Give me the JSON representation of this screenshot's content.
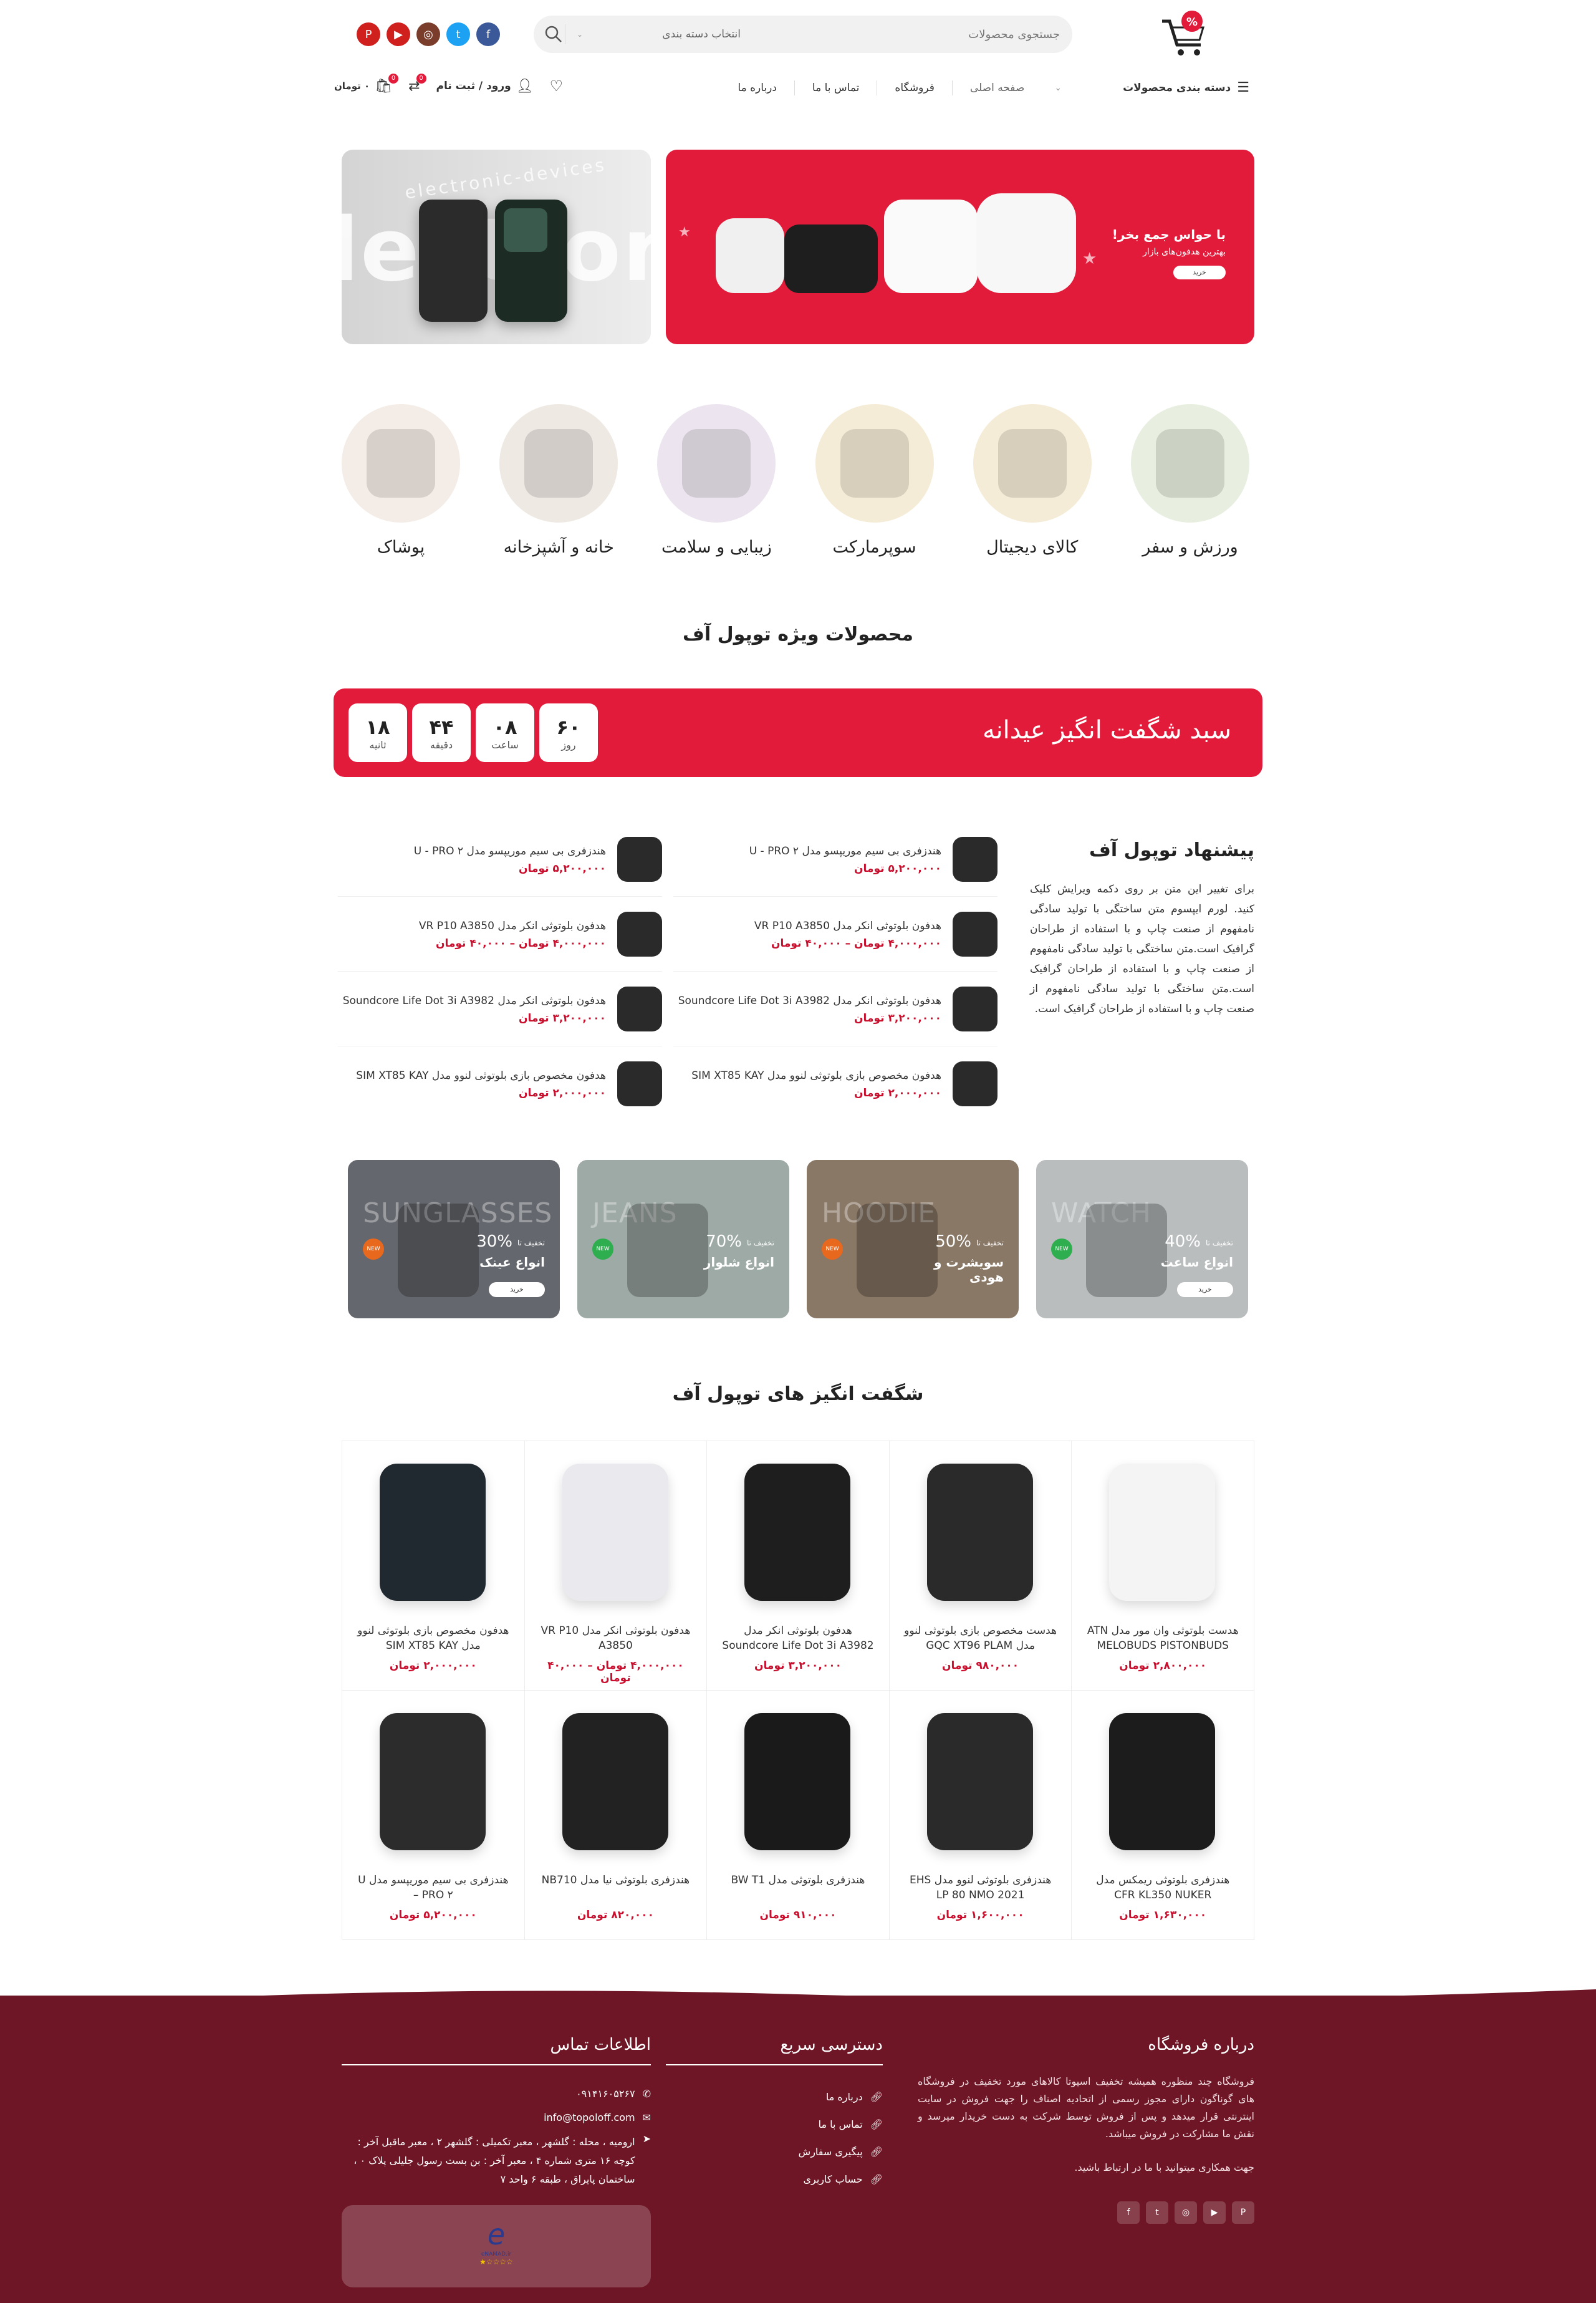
{
  "header": {
    "search_placeholder": "جستجوی محصولات",
    "category_select": "انتخاب دسته بندی",
    "social": [
      {
        "name": "pinterest-icon",
        "glyph": "P",
        "color": "#d0201e"
      },
      {
        "name": "youtube-icon",
        "glyph": "▶",
        "color": "#d0201e"
      },
      {
        "name": "instagram-icon",
        "glyph": "◎",
        "color": "#7a3d2b"
      },
      {
        "name": "twitter-icon",
        "glyph": "t",
        "color": "#1da1f2"
      },
      {
        "name": "facebook-icon",
        "glyph": "f",
        "color": "#3b5998"
      }
    ]
  },
  "nav": {
    "categories_label": "دسته بندی محصولات",
    "home": "صفحه اصلی",
    "shop": "فروشگاه",
    "contact": "تماس با ما",
    "about": "درباره ما",
    "login": "ورود / ثبت نام",
    "cart_total": "۰ تومان",
    "compare_badge": "0",
    "cart_badge": "0"
  },
  "banners": {
    "red_title": "با حواس جمع بخر!",
    "red_sub": "بهترین هدفون‌های بازار",
    "red_btn": "خرید",
    "gray_text": "electronic-devices",
    "gray_big": "lectronic"
  },
  "categories": [
    {
      "label": "ورزش و سفر"
    },
    {
      "label": "کالای دیجیتال"
    },
    {
      "label": "سوپرمارکت"
    },
    {
      "label": "زیبایی و سلامت"
    },
    {
      "label": "خانه و آشپزخانه"
    },
    {
      "label": "پوشاک"
    }
  ],
  "special_title": "محصولات ویژه توپول آف",
  "countdown": {
    "title": "سبد شگفت انگیز عیدانه",
    "units": [
      {
        "value": "۱۸",
        "label": "ثانیه"
      },
      {
        "value": "۴۴",
        "label": "دقیقه"
      },
      {
        "value": "۰۸",
        "label": "ساعت"
      },
      {
        "value": "۶۰",
        "label": "روز"
      }
    ]
  },
  "offer": {
    "title": "پیشنهاد توپول آف",
    "text": "برای تغییر این متن بر روی دکمه ویرایش کلیک کنید. لورم ایپسوم متن ساختگی با تولید سادگی نامفهوم از صنعت چاپ و با استفاده از طراحان گرافیک است.متن ساختگی با تولید سادگی نامفهوم از صنعت چاپ و با استفاده از طراحان گرافیک است.متن ساختگی با تولید سادگی نامفهوم از صنعت چاپ و با استفاده از طراحان گرافیک است."
  },
  "offer_list": [
    {
      "title": "هندزفری بی سیم موریپسو مدل U - PRO ۲",
      "price": "۵,۲۰۰,۰۰۰ تومان"
    },
    {
      "title": "هدفون بلوتوثی انکر مدل VR P10 A3850",
      "price": "۴,۰۰۰,۰۰۰ تومان – ۴۰,۰۰۰ تومان"
    },
    {
      "title": "هدفون بلوتوثی انکر مدل Soundcore Life Dot 3i A3982",
      "price": "۳,۲۰۰,۰۰۰ تومان"
    },
    {
      "title": "هدفون مخصوص بازی بلوتوثی لنوو مدل SIM XT85 KAY",
      "price": "۲,۰۰۰,۰۰۰ تومان"
    }
  ],
  "promos": [
    {
      "bg": "SUNGLASSES",
      "discount": "30%",
      "off": "تخفیف تا",
      "title": "انواع عینک",
      "btn": "خرید",
      "badge": "NEW"
    },
    {
      "bg": "JEANS",
      "discount": "70%",
      "off": "تخفیف تا",
      "title": "انواع شلوار",
      "btn": "",
      "badge": "NEW"
    },
    {
      "bg": "HOODIE",
      "discount": "50%",
      "off": "تخفیف تا",
      "title": "سویشرت و هودی",
      "btn": "",
      "badge": "NEW"
    },
    {
      "bg": "WATCH",
      "discount": "40%",
      "off": "تخفیف تا",
      "title": "انواع ساعت",
      "btn": "خرید",
      "badge": "NEW"
    }
  ],
  "amazing_title": "شگفت انگیز های توپول آف",
  "products": [
    {
      "title": "هدست بلوتوثی وان مور مدل ATN MELOBUDS PISTONBUDS",
      "price": "۲,۸۰۰,۰۰۰ تومان"
    },
    {
      "title": "هدست مخصوص بازی بلوتوثی لنوو مدل GQC XT96 PLAM",
      "price": "۹۸۰,۰۰۰ تومان"
    },
    {
      "title": "هدفون بلوتوثی انکر مدل Soundcore Life Dot 3i A3982",
      "price": "۳,۲۰۰,۰۰۰ تومان"
    },
    {
      "title": "هدفون بلوتوثی انکر مدل VR P10 A3850",
      "price": "۴,۰۰۰,۰۰۰ تومان – ۴۰,۰۰۰ تومان"
    },
    {
      "title": "هدفون مخصوص بازی بلوتوثی لنوو مدل SIM XT85 KAY",
      "price": "۲,۰۰۰,۰۰۰ تومان"
    },
    {
      "title": "هندزفری بلوتوثی ریمکس مدل CFR KL350 NUKER",
      "price": "۱,۶۳۰,۰۰۰ تومان"
    },
    {
      "title": "هندزفری بلوتوثی لنوو مدل EHS LP 80 NMO 2021",
      "price": "۱,۶۰۰,۰۰۰ تومان"
    },
    {
      "title": "هندزفری بلوتوثی مدل BW T1",
      "price": "۹۱۰,۰۰۰ تومان"
    },
    {
      "title": "هندزفری بلوتوثی نیا مدل NB710",
      "price": "۸۲۰,۰۰۰ تومان"
    },
    {
      "title": "هندزفری بی سیم موریپسو مدل U – PRO ۲",
      "price": "۵,۲۰۰,۰۰۰ تومان"
    }
  ],
  "footer": {
    "about_title": "درباره فروشگاه",
    "about_text": "فروشگاه چند منظوره همیشه تخفیف اسپوتا کالاهای مورد تخفیف در فروشگاه های گوناگون دارای مجوز رسمی از اتحادیه اصناف را جهت فروش در سایت اینترنتی قرار میدهد و پس از فروش توسط شرکت به دست خریدار میرسد و نقش ما مشارکت در فروش میباشد.",
    "about_text2": "جهت همکاری میتوانید با ما در ارتباط باشید.",
    "quick_title": "دسترسی سریع",
    "quick_links": [
      "درباره ما",
      "تماس با ما",
      "پیگیری سفارش",
      "حساب کاربری"
    ],
    "contact_title": "اطلاعات تماس",
    "phone": "۰۹۱۴۱۶۰۵۲۶۷",
    "email": "info@topoloff.com",
    "address": "ارومیه ، محله : گلشهر ، معبر تکمیلی : گلشهر ۲ ، معبر ماقبل آخر : کوچه ۱۶ متری شماره ۴ ، معبر آخر : بن بست رسول جلیلی پلاک ۰ ، ساختمان پایراق ، طبقه ۶ واحد ۷",
    "enamad": "eNAMAD.ir",
    "social": [
      "pinterest-icon",
      "youtube-icon",
      "instagram-icon",
      "twitter-icon",
      "facebook-icon"
    ],
    "social_glyphs": [
      "P",
      "▶",
      "◎",
      "t",
      "f"
    ]
  },
  "colors": {
    "accent": "#e31b3b",
    "footer": "#6e1626",
    "badge_new": "#e8681d",
    "badge_new2": "#2eae4f"
  }
}
